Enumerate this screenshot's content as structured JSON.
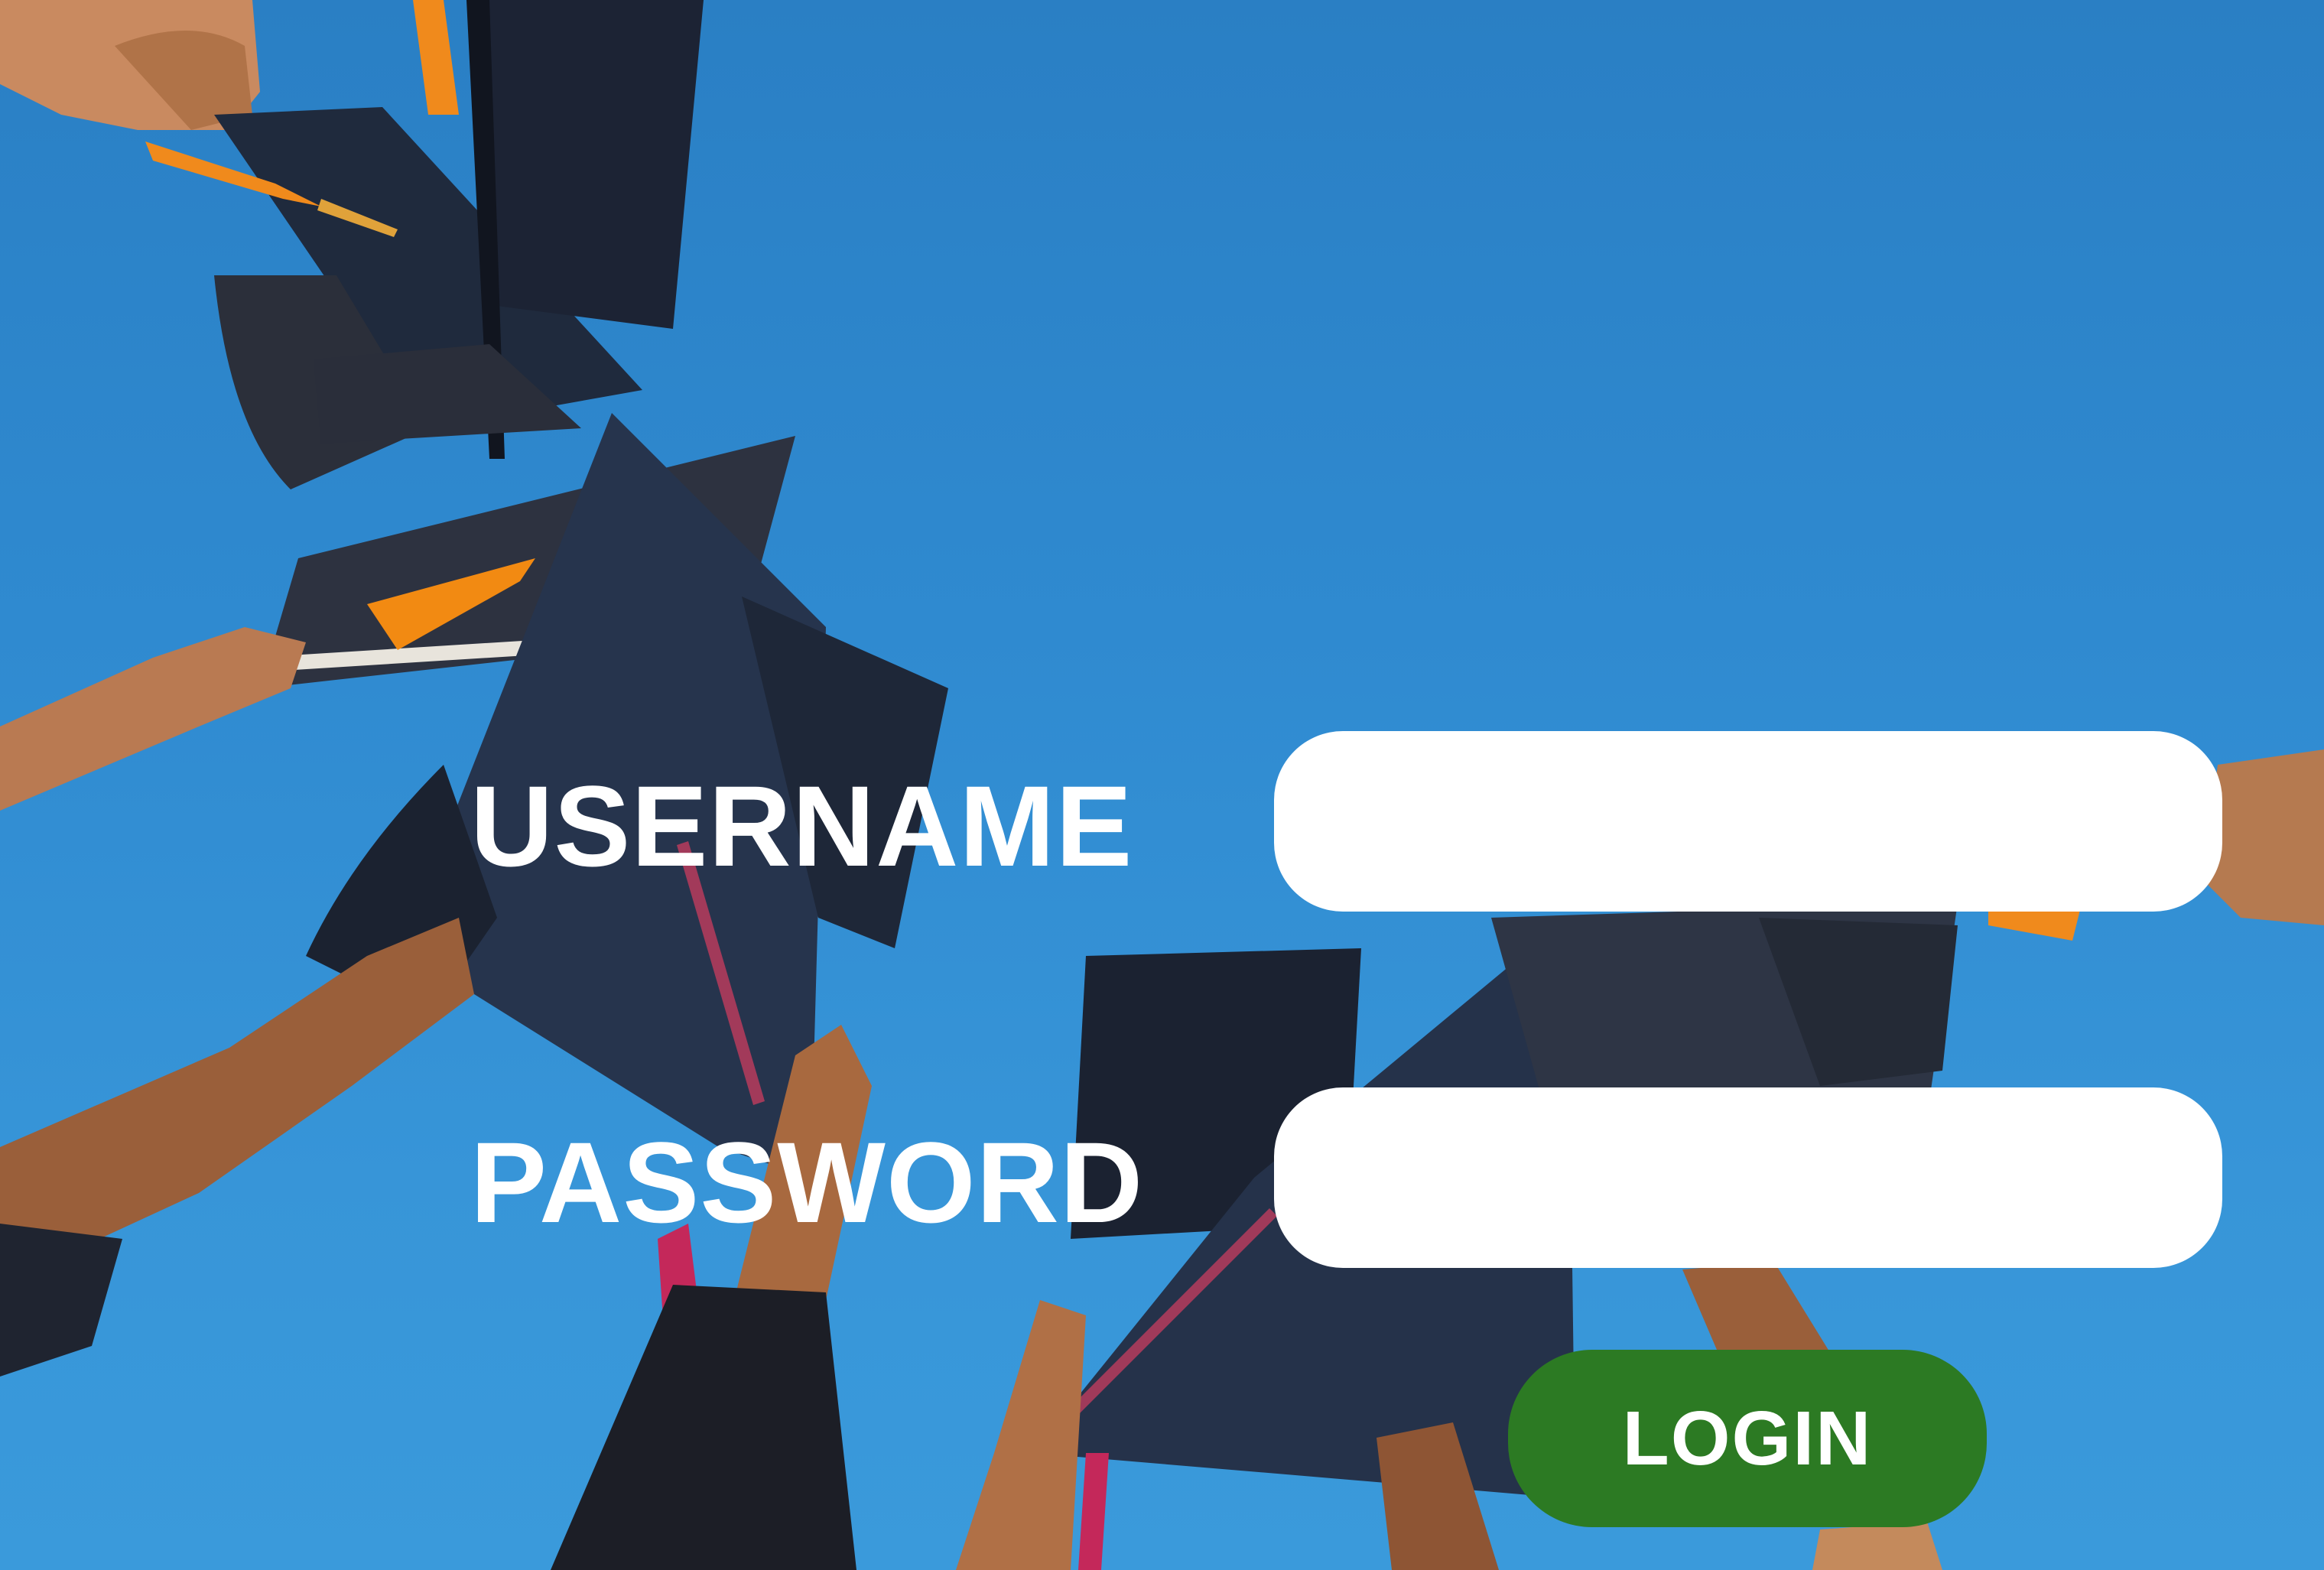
{
  "form": {
    "username_label": "USERNAME",
    "username_value": "",
    "password_label": "PASSWORD",
    "password_value": "",
    "login_label": "LOGIN"
  },
  "colors": {
    "sky": "#2f8ad0",
    "field_background": "#ffffff",
    "label_text": "#ffffff",
    "login_button": "#2c7a23",
    "cap": "#1f2a3d",
    "tassel": "#f08a1c"
  },
  "background": {
    "scene": "graduation-caps-tossed-against-sky"
  }
}
